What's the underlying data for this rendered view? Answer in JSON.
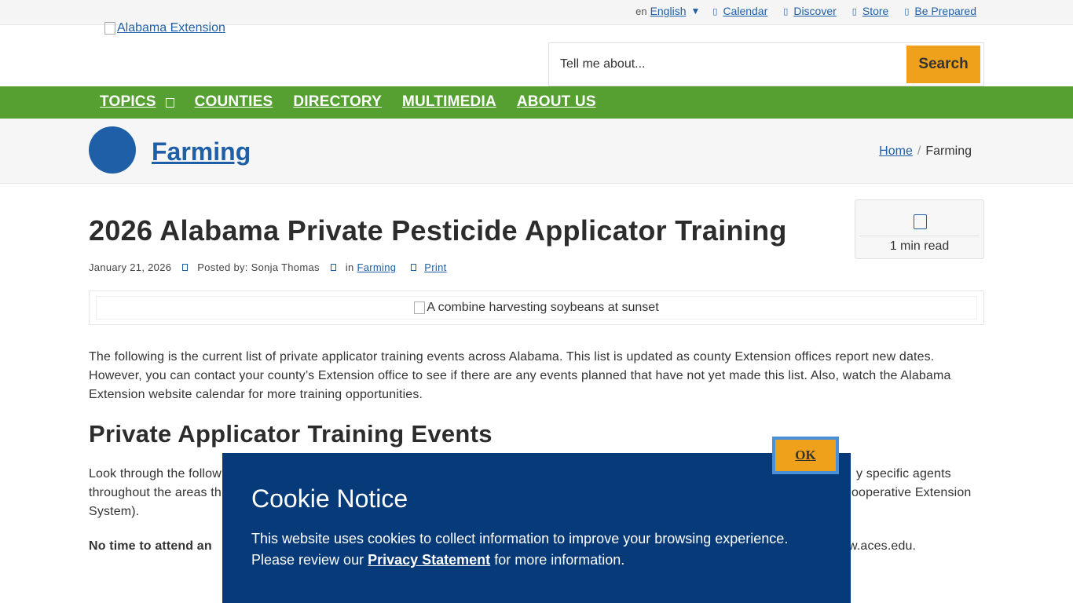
{
  "utility": {
    "lang_img_alt": "en",
    "lang_label": "English",
    "lang_caret": "▼",
    "links": [
      "Calendar",
      "Discover",
      "Store",
      "Be Prepared"
    ]
  },
  "logo": {
    "alt": "Alabama Extension"
  },
  "search": {
    "placeholder": "Tell me about...",
    "button": "Search"
  },
  "nav": {
    "items": [
      "TOPICS",
      "COUNTIES",
      "DIRECTORY",
      "MULTIMEDIA",
      "ABOUT US"
    ]
  },
  "topic": {
    "title": "Farming"
  },
  "breadcrumb": {
    "home": "Home",
    "sep": "/",
    "current": "Farming"
  },
  "read": {
    "time": "1 min read"
  },
  "article": {
    "title": "2026 Alabama Private Pesticide Applicator Training",
    "date": "January 21, 2026",
    "author": "Posted by: Sonja Thomas",
    "in_label": "in",
    "category": "Farming",
    "print": "Print",
    "hero_alt": "A combine harvesting soybeans at sunset",
    "intro": "The following is the current list of private applicator training events across Alabama. This list is updated as county Extension offices report new dates. However, you can contact your county’s Extension office to see if there are any events planned that have not yet made this list. Also, watch the Alabama Extension website calendar for more training opportunities.",
    "section_heading": "Private Applicator Training Events",
    "p2_line1_start": "Look through the follow",
    "p2_line1_end": "y specific agents",
    "p2_line2_start": "throughout the areas th",
    "p2_line2_end": "ooperative Extension",
    "p2_line3": "System).",
    "p3_bold": "No time to attend an",
    "p3_tail": "w.aces.edu."
  },
  "cookie": {
    "title": "Cookie Notice",
    "body_line1": "This website uses cookies to collect information to improve your browsing experience.",
    "body_pre": "Please review our",
    "link": "Privacy Statement",
    "body_post": "for more information.",
    "ok": "OK"
  },
  "colors": {
    "nav_green": "#55a030",
    "brand_blue": "#1f5fa8",
    "cookie_navy": "#063a78",
    "accent_orange": "#f0a11b"
  }
}
